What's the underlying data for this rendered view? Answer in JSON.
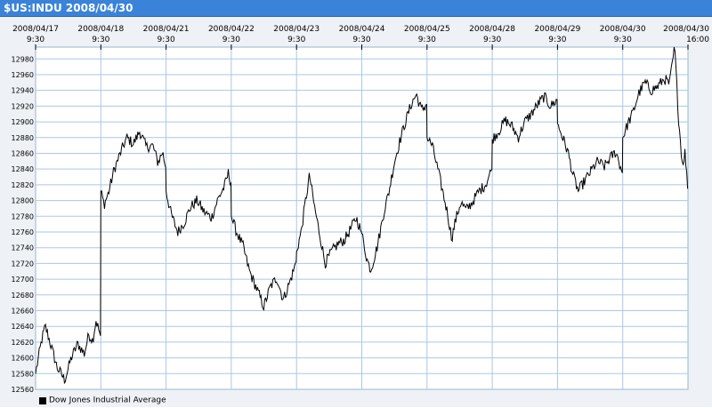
{
  "window": {
    "title": "$US:INDU 2008/04/30"
  },
  "legend": {
    "label": "Dow Jones Industrial Average",
    "swatch_color": "#000000"
  },
  "colors": {
    "title_bar": "#3a83d8",
    "grid": "#a9c7ea",
    "line": "#000000",
    "panel": "#eef1f5"
  },
  "chart_data": {
    "type": "line",
    "title": "$US:INDU 2008/04/30",
    "xlabel": "",
    "ylabel": "",
    "grid": true,
    "legend_position": "bottom-left",
    "x_ticks": [
      {
        "date": "2008/04/17",
        "time": "9:30"
      },
      {
        "date": "2008/04/18",
        "time": "9:30"
      },
      {
        "date": "2008/04/21",
        "time": "9:30"
      },
      {
        "date": "2008/04/22",
        "time": "9:30"
      },
      {
        "date": "2008/04/23",
        "time": "9:30"
      },
      {
        "date": "2008/04/24",
        "time": "9:30"
      },
      {
        "date": "2008/04/25",
        "time": "9:30"
      },
      {
        "date": "2008/04/28",
        "time": "9:30"
      },
      {
        "date": "2008/04/29",
        "time": "9:30"
      },
      {
        "date": "2008/04/30",
        "time": "9:30"
      },
      {
        "date": "2008/04/30",
        "time": "16:00"
      }
    ],
    "y_ticks": [
      12560,
      12580,
      12600,
      12620,
      12640,
      12660,
      12680,
      12700,
      12720,
      12740,
      12760,
      12780,
      12800,
      12820,
      12840,
      12860,
      12880,
      12900,
      12920,
      12940,
      12960,
      12980
    ],
    "ylim": [
      12560,
      12995
    ],
    "series": [
      {
        "name": "Dow Jones Industrial Average",
        "days": [
          "2008/04/17",
          "2008/04/18",
          "2008/04/21",
          "2008/04/22",
          "2008/04/23",
          "2008/04/24",
          "2008/04/25",
          "2008/04/28",
          "2008/04/29",
          "2008/04/30"
        ],
        "day_points": [
          [
            [
              0,
              12580
            ],
            [
              0.05,
              12603
            ],
            [
              0.1,
              12625
            ],
            [
              0.15,
              12640
            ],
            [
              0.25,
              12612
            ],
            [
              0.33,
              12588
            ],
            [
              0.45,
              12572
            ],
            [
              0.55,
              12600
            ],
            [
              0.65,
              12618
            ],
            [
              0.75,
              12605
            ],
            [
              0.82,
              12630
            ],
            [
              0.88,
              12622
            ],
            [
              0.93,
              12648
            ],
            [
              1,
              12628
            ]
          ],
          [
            [
              0,
              12812
            ],
            [
              0.05,
              12795
            ],
            [
              0.12,
              12810
            ],
            [
              0.2,
              12838
            ],
            [
              0.3,
              12860
            ],
            [
              0.4,
              12880
            ],
            [
              0.5,
              12872
            ],
            [
              0.6,
              12888
            ],
            [
              0.7,
              12868
            ],
            [
              0.8,
              12870
            ],
            [
              0.88,
              12848
            ],
            [
              0.95,
              12862
            ],
            [
              1,
              12842
            ]
          ],
          [
            [
              0,
              12812
            ],
            [
              0.08,
              12782
            ],
            [
              0.18,
              12760
            ],
            [
              0.28,
              12772
            ],
            [
              0.38,
              12792
            ],
            [
              0.48,
              12800
            ],
            [
              0.58,
              12786
            ],
            [
              0.7,
              12778
            ],
            [
              0.8,
              12802
            ],
            [
              0.9,
              12818
            ],
            [
              0.96,
              12835
            ],
            [
              1,
              12822
            ]
          ],
          [
            [
              0,
              12780
            ],
            [
              0.08,
              12760
            ],
            [
              0.18,
              12742
            ],
            [
              0.28,
              12710
            ],
            [
              0.4,
              12686
            ],
            [
              0.5,
              12665
            ],
            [
              0.6,
              12690
            ],
            [
              0.7,
              12702
            ],
            [
              0.8,
              12674
            ],
            [
              0.9,
              12696
            ],
            [
              1,
              12722
            ]
          ],
          [
            [
              0,
              12735
            ],
            [
              0.07,
              12760
            ],
            [
              0.14,
              12800
            ],
            [
              0.2,
              12832
            ],
            [
              0.28,
              12790
            ],
            [
              0.36,
              12756
            ],
            [
              0.44,
              12720
            ],
            [
              0.54,
              12735
            ],
            [
              0.64,
              12745
            ],
            [
              0.74,
              12750
            ],
            [
              0.84,
              12765
            ],
            [
              0.92,
              12778
            ],
            [
              1,
              12760
            ]
          ],
          [
            [
              0,
              12758
            ],
            [
              0.08,
              12725
            ],
            [
              0.14,
              12712
            ],
            [
              0.24,
              12742
            ],
            [
              0.34,
              12785
            ],
            [
              0.42,
              12812
            ],
            [
              0.5,
              12848
            ],
            [
              0.6,
              12880
            ],
            [
              0.68,
              12902
            ],
            [
              0.76,
              12922
            ],
            [
              0.84,
              12935
            ],
            [
              0.92,
              12915
            ],
            [
              1,
              12922
            ]
          ],
          [
            [
              0,
              12880
            ],
            [
              0.08,
              12870
            ],
            [
              0.16,
              12842
            ],
            [
              0.24,
              12812
            ],
            [
              0.32,
              12782
            ],
            [
              0.38,
              12752
            ],
            [
              0.44,
              12775
            ],
            [
              0.52,
              12798
            ],
            [
              0.6,
              12788
            ],
            [
              0.7,
              12798
            ],
            [
              0.8,
              12812
            ],
            [
              0.9,
              12820
            ],
            [
              1,
              12840
            ]
          ],
          [
            [
              0,
              12878
            ],
            [
              0.1,
              12888
            ],
            [
              0.2,
              12902
            ],
            [
              0.3,
              12895
            ],
            [
              0.4,
              12880
            ],
            [
              0.5,
              12900
            ],
            [
              0.6,
              12910
            ],
            [
              0.7,
              12922
            ],
            [
              0.8,
              12932
            ],
            [
              0.9,
              12920
            ],
            [
              1,
              12928
            ]
          ],
          [
            [
              0,
              12898
            ],
            [
              0.08,
              12880
            ],
            [
              0.16,
              12862
            ],
            [
              0.24,
              12832
            ],
            [
              0.32,
              12812
            ],
            [
              0.42,
              12825
            ],
            [
              0.52,
              12838
            ],
            [
              0.62,
              12850
            ],
            [
              0.72,
              12843
            ],
            [
              0.82,
              12855
            ],
            [
              0.9,
              12862
            ],
            [
              1,
              12835
            ]
          ],
          [
            [
              0,
              12880
            ],
            [
              0.08,
              12898
            ],
            [
              0.16,
              12912
            ],
            [
              0.24,
              12935
            ],
            [
              0.34,
              12950
            ],
            [
              0.44,
              12940
            ],
            [
              0.54,
              12945
            ],
            [
              0.64,
              12955
            ],
            [
              0.72,
              12948
            ],
            [
              0.8,
              12995
            ],
            [
              0.86,
              12905
            ],
            [
              0.92,
              12845
            ],
            [
              0.96,
              12862
            ],
            [
              1,
              12815
            ]
          ]
        ]
      }
    ]
  }
}
